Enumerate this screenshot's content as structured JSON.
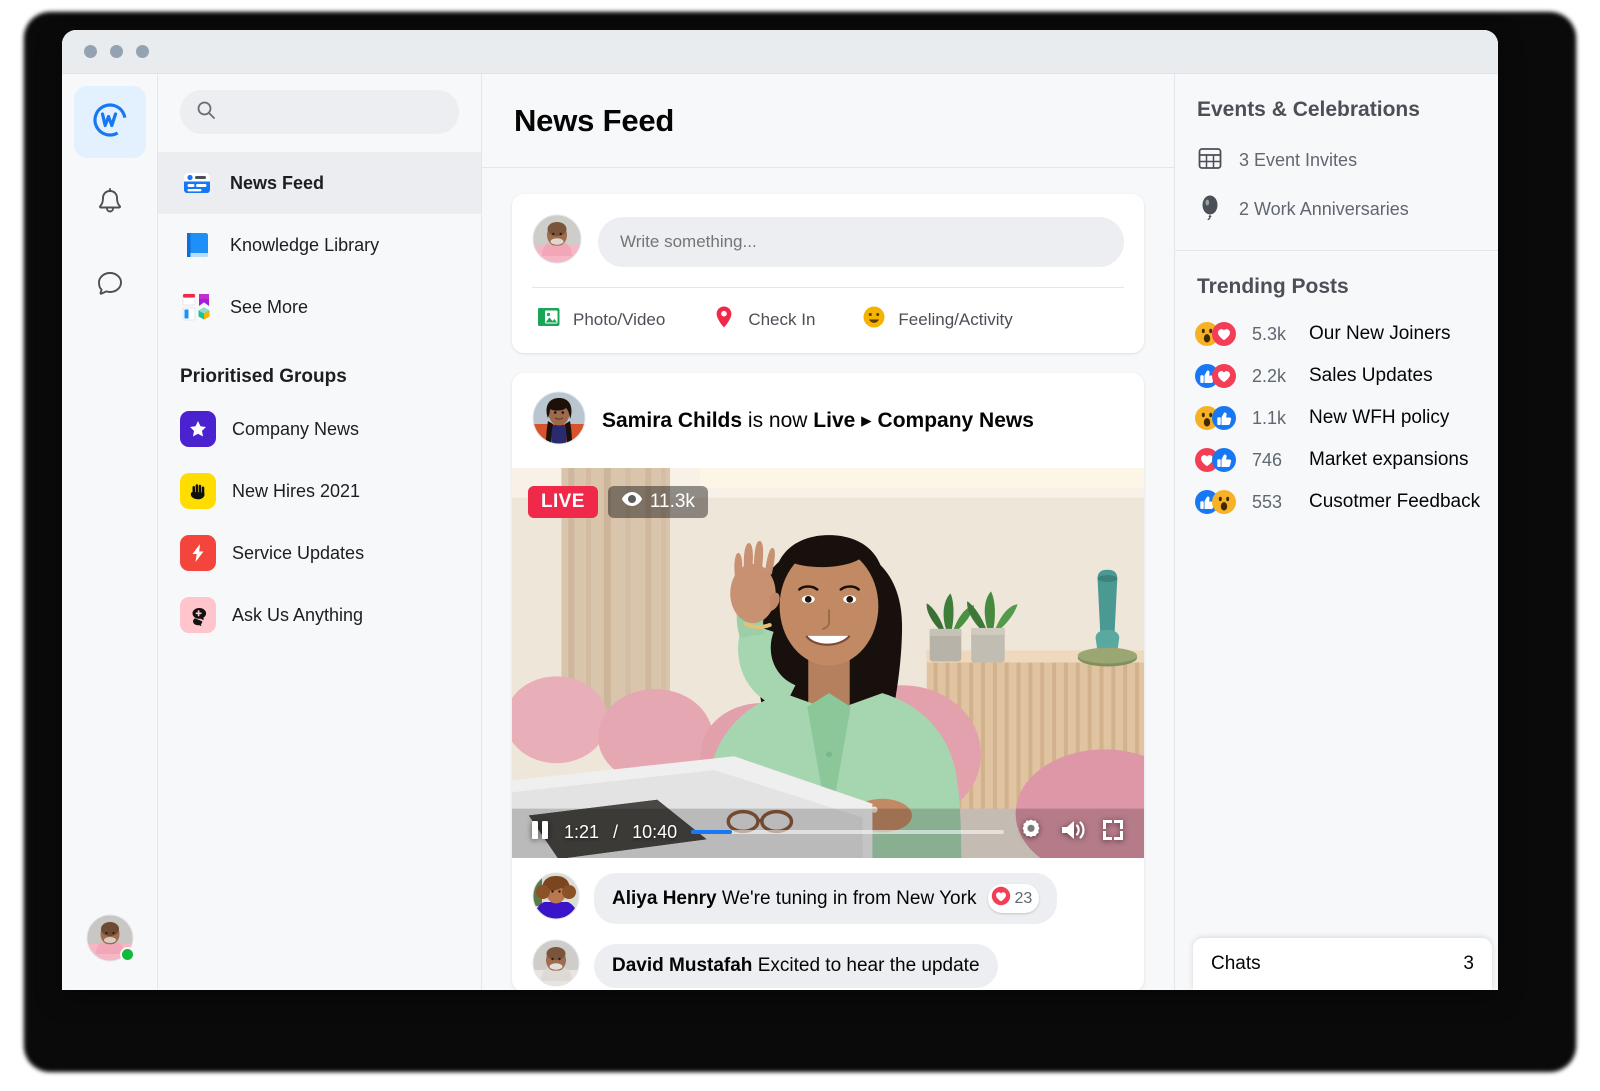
{
  "window": {
    "traffic_lights": [
      "close",
      "minimize",
      "maximize"
    ]
  },
  "rail": {
    "items": [
      {
        "name": "workplace-home",
        "icon": "workplace-logo-icon",
        "active": true
      },
      {
        "name": "notifications",
        "icon": "bell-icon",
        "active": false
      },
      {
        "name": "chat",
        "icon": "chat-bubble-icon",
        "active": false
      }
    ],
    "avatar_status": "online"
  },
  "search": {
    "value": "",
    "placeholder": "",
    "icon": "search-icon"
  },
  "nav": {
    "items": [
      {
        "label": "News Feed",
        "icon": "news-feed-icon",
        "active": true
      },
      {
        "label": "Knowledge Library",
        "icon": "book-icon",
        "active": false
      },
      {
        "label": "See More",
        "icon": "apps-grid-icon",
        "active": false
      }
    ],
    "groups_title": "Prioritised Groups",
    "groups": [
      {
        "label": "Company News",
        "icon": "star-icon",
        "color": "#4a22cf",
        "glyph": "★"
      },
      {
        "label": "New Hires 2021",
        "icon": "waving-hand-icon",
        "color": "#ffdd00",
        "glyph": "✋"
      },
      {
        "label": "Service Updates",
        "icon": "lightning-bolt-icon",
        "color": "#f4453c",
        "glyph": "⚡"
      },
      {
        "label": "Ask Us Anything",
        "icon": "question-chat-icon",
        "color": "#ffc4cc",
        "glyph": "✚"
      }
    ]
  },
  "header": {
    "title": "News Feed"
  },
  "composer": {
    "placeholder": "Write something...",
    "value": "",
    "actions": [
      {
        "label": "Photo/Video",
        "icon": "photo-video-icon",
        "color": "#18a558"
      },
      {
        "label": "Check In",
        "icon": "location-pin-icon",
        "color": "#f02849"
      },
      {
        "label": "Feeling/Activity",
        "icon": "smiley-face-icon",
        "color": "#f5b301"
      }
    ]
  },
  "post": {
    "author": "Samira Childs",
    "status_text": "is now",
    "live_word": "Live",
    "separator_icon": "play-triangle-icon",
    "group": "Company News",
    "video": {
      "live_badge": "LIVE",
      "viewers": "11.3k",
      "viewers_icon": "eye-icon",
      "current_time": "1:21",
      "time_separator": "/",
      "duration": "10:40",
      "progress_percent": 13,
      "play_state_icon": "pause-icon",
      "controls": [
        "settings-gear-icon",
        "volume-icon",
        "fullscreen-icon"
      ]
    },
    "comments": [
      {
        "author": "Aliya Henry",
        "text": "We're tuning in from New York",
        "reaction_icon": "heart-icon",
        "reaction_count": "23"
      },
      {
        "author": "David Mustafah",
        "text": "Excited to hear the update",
        "reaction_icon": "",
        "reaction_count": ""
      }
    ]
  },
  "right": {
    "events_title": "Events & Celebrations",
    "events": [
      {
        "label": "3 Event Invites",
        "icon": "calendar-icon"
      },
      {
        "label": "2 Work Anniversaries",
        "icon": "balloon-icon"
      }
    ],
    "trending_title": "Trending Posts",
    "trending": [
      {
        "count": "5.3k",
        "label": "Our New Joiners",
        "reactions": [
          "wow-icon",
          "love-icon"
        ]
      },
      {
        "count": "2.2k",
        "label": "Sales Updates",
        "reactions": [
          "like-icon",
          "love-icon"
        ]
      },
      {
        "count": "1.1k",
        "label": "New WFH policy",
        "reactions": [
          "wow-icon",
          "like-icon"
        ]
      },
      {
        "count": "746",
        "label": "Market expansions",
        "reactions": [
          "love-icon",
          "like-icon"
        ]
      },
      {
        "count": "553",
        "label": "Cusotmer Feedback",
        "reactions": [
          "like-icon",
          "wow-icon"
        ]
      }
    ],
    "chats_label": "Chats",
    "chats_count": "3"
  },
  "colors": {
    "brand_blue": "#1877f2",
    "live_red": "#f02849",
    "online_green": "#14b83c",
    "page_bg": "#f7f8fa"
  }
}
